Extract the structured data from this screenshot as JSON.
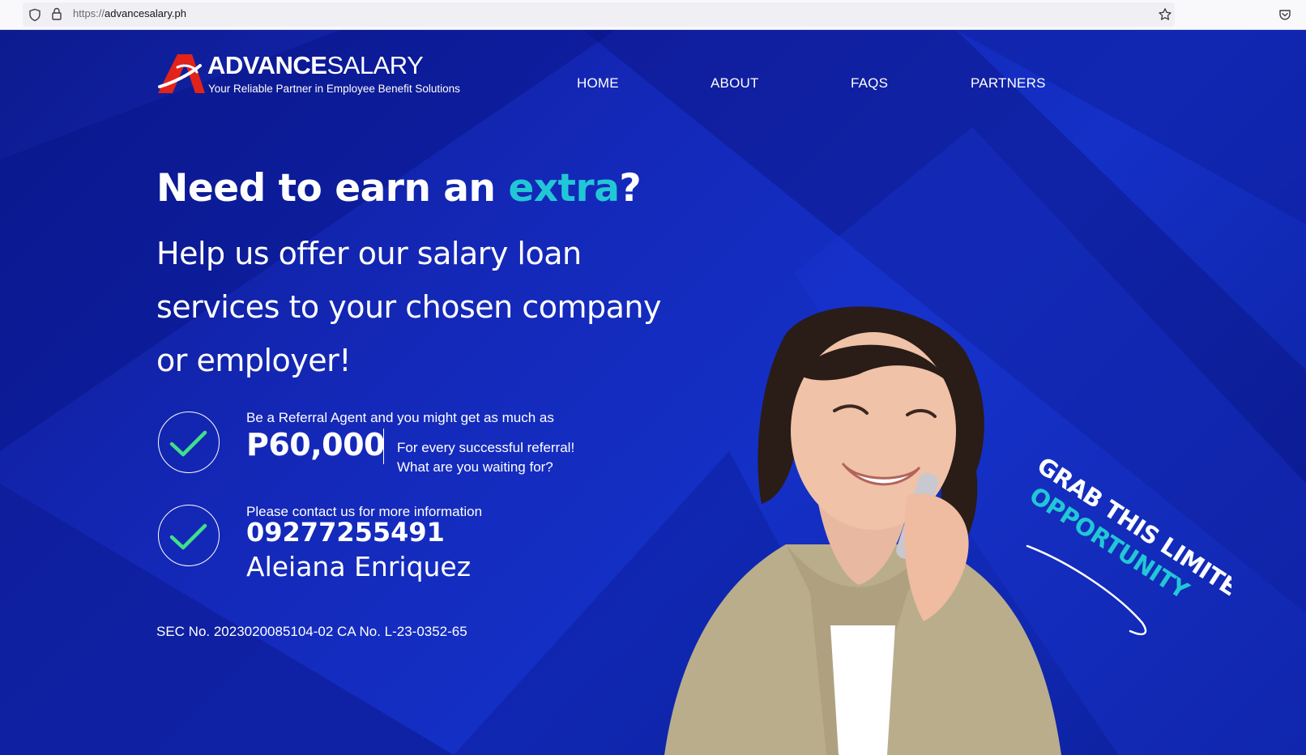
{
  "browser": {
    "url_scheme": "https://",
    "url_host": "advancesalary.ph",
    "icons": {
      "shield": "shield-icon",
      "lock": "lock-icon",
      "bookmark": "star-icon",
      "pocket": "pocket-icon"
    }
  },
  "brand": {
    "name_bold": "ADVANCE",
    "name_light": "SALARY",
    "tagline": "Your Reliable Partner in Employee Benefit Solutions",
    "colors": {
      "background": "#1428b8",
      "accent": "#22c7d6",
      "logo_red": "#e2231a",
      "text": "#ffffff"
    }
  },
  "nav": {
    "home": "HOME",
    "about": "ABOUT",
    "faqs": "FAQS",
    "partners": "PARTNERS"
  },
  "hero": {
    "headline_pre": "Need to earn an ",
    "headline_accent": "extra",
    "headline_post": "?",
    "subhead_line1": "Help us offer our salary loan",
    "subhead_line2": "services to your chosen company",
    "subhead_line3": "or employer!"
  },
  "referral": {
    "intro": "Be a Referral Agent and you might get as much as",
    "amount": "P60,000",
    "note_line1": "For every successful referral!",
    "note_line2": "What are you waiting for?"
  },
  "contact": {
    "intro": "Please contact us for more information",
    "phone": "09277255491",
    "name": "Aleiana Enriquez"
  },
  "legal": {
    "registration": "SEC No. 2023020085104-02 CA No. L-23-0352-65"
  },
  "badge": {
    "line1": "GRAB THIS LIMITED",
    "line2": "OPPORTUNITY"
  }
}
